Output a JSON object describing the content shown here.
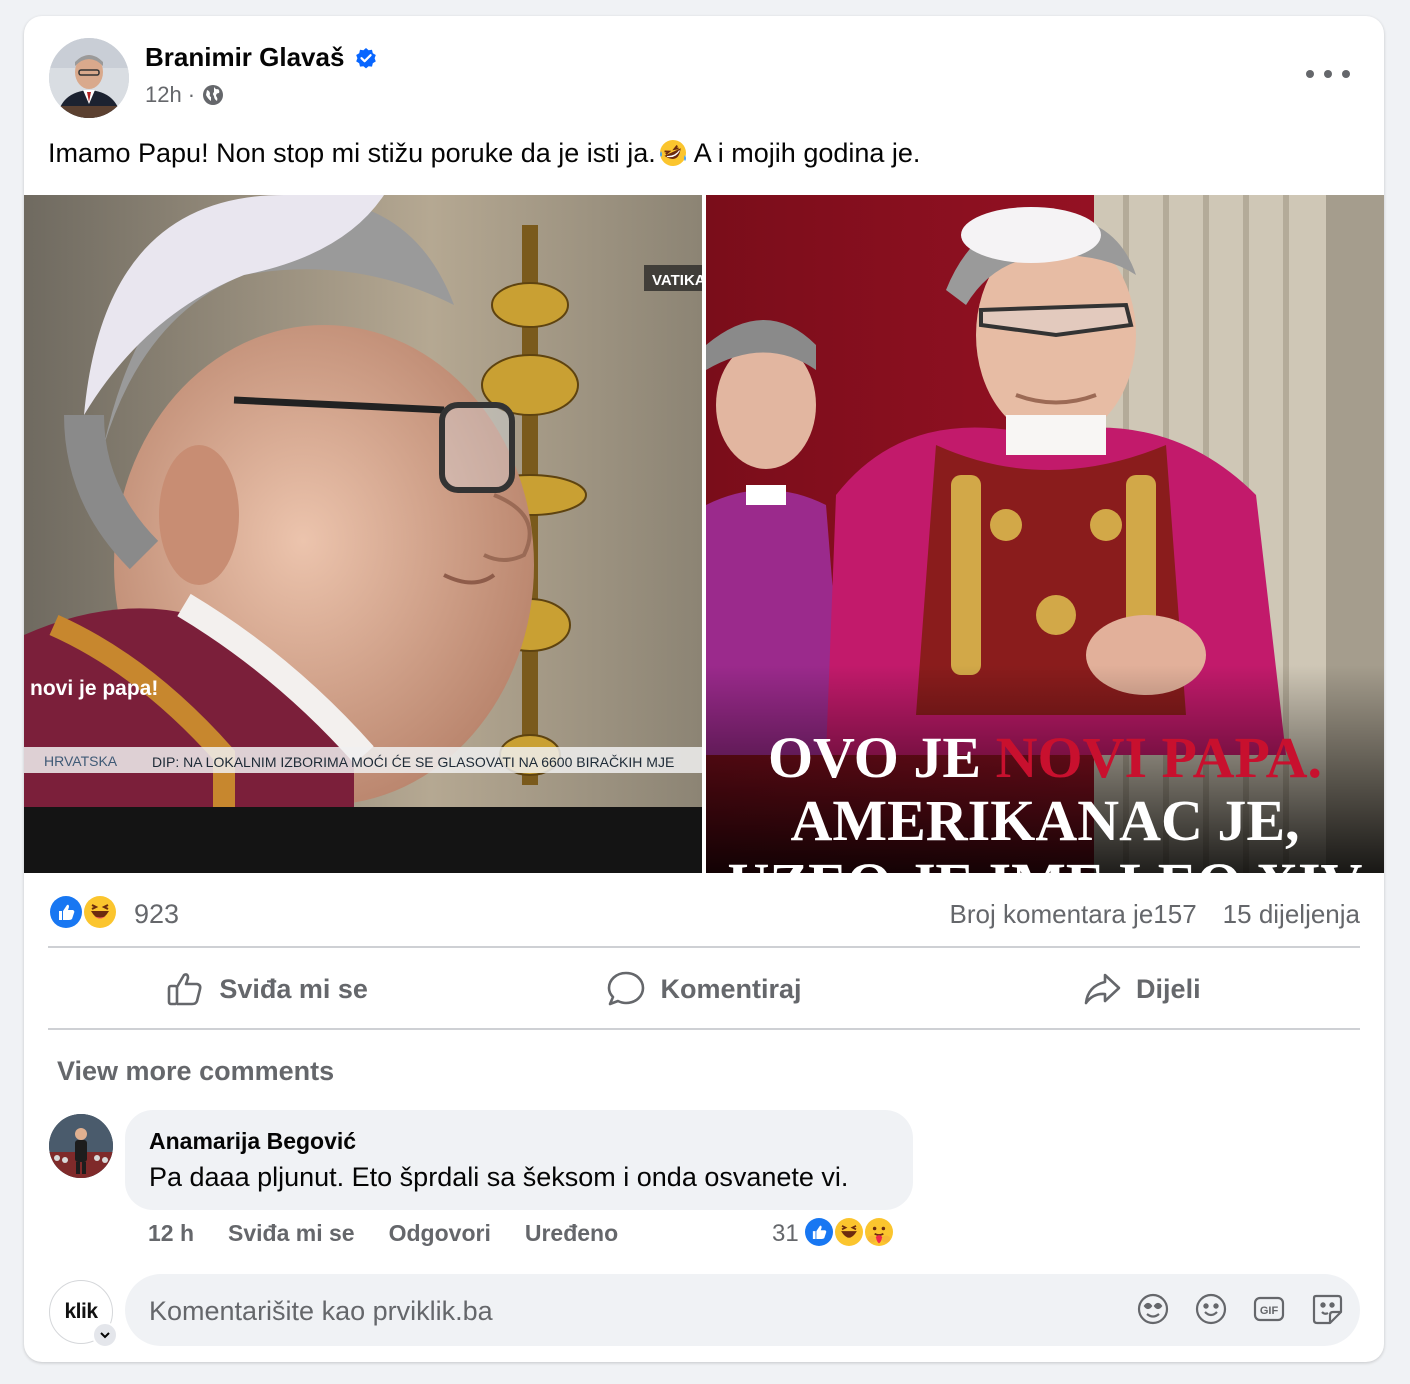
{
  "post": {
    "author": "Branimir Glavaš",
    "time": "12h",
    "privacy_icon": "globe-icon",
    "text_before_emoji": "Imamo Papu! Non stop mi stižu poruke da je isti ja.",
    "text_after_emoji": "A i mojih godina je.",
    "emoji": "rolling-on-floor-laughing"
  },
  "photos": {
    "left": {
      "tv_tag": "VATIKA",
      "caption": "novi je papa!",
      "ticker_channel": "HRVATSKA",
      "ticker_text": "DIP: NA LOKALNIM IZBORIMA MOĆI ĆE SE GLASOVATI NA 6600 BIRAČKIH MJE"
    },
    "right": {
      "line1_white": "OVO JE ",
      "line1_red": "NOVI PAPA.",
      "line2": "AMERIKANAC JE,",
      "line3": "UZEO JE IME LEO XIV"
    }
  },
  "stats": {
    "reactions_count": "923",
    "comments": "Broj komentara je157",
    "shares": "15 dijeljenja"
  },
  "actions": {
    "like": "Sviđa mi se",
    "comment": "Komentiraj",
    "share": "Dijeli"
  },
  "comments_section": {
    "view_more": "View more comments",
    "comment": {
      "name": "Anamarija Begović",
      "text": "Pa daaa pljunut. Eto šprdali sa šeksom i onda osvanete vi.",
      "time": "12 h",
      "like": "Sviđa mi se",
      "reply": "Odgovori",
      "edited": "Uređeno",
      "reactions_count": "31"
    }
  },
  "composer": {
    "avatar_text": "klik",
    "placeholder": "Komentarišite kao prviklik.ba",
    "icons": [
      "avatar-sticker-icon",
      "emoji-icon",
      "gif-icon",
      "sticker-icon"
    ]
  },
  "colors": {
    "accent_blue": "#0866ff",
    "text_secondary": "#65676b",
    "divider": "#ced0d4",
    "bubble": "#f0f2f5",
    "red_overlay_text": "#c8102e"
  }
}
